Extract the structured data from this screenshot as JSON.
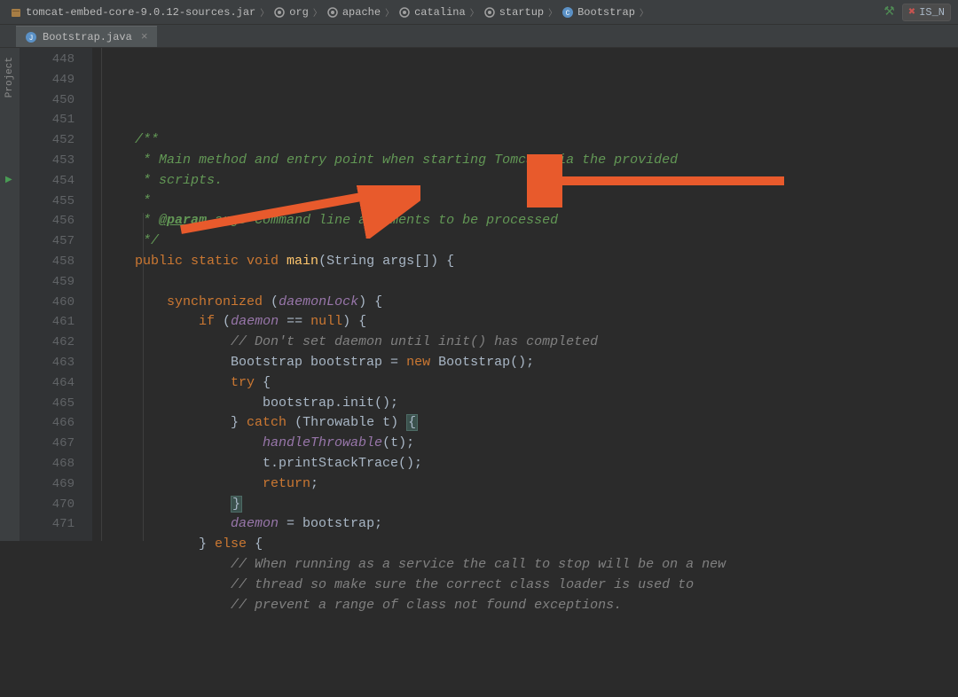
{
  "breadcrumb": {
    "items": [
      {
        "label": "tomcat-embed-core-9.0.12-sources.jar",
        "icon": "jar"
      },
      {
        "label": "org",
        "icon": "package"
      },
      {
        "label": "apache",
        "icon": "package"
      },
      {
        "label": "catalina",
        "icon": "package"
      },
      {
        "label": "startup",
        "icon": "package"
      },
      {
        "label": "Bootstrap",
        "icon": "class"
      }
    ]
  },
  "run_config": {
    "label": "IS_N"
  },
  "tab": {
    "filename": "Bootstrap.java"
  },
  "side_panel": {
    "label": "Project"
  },
  "gutter": {
    "start": 448,
    "end": 471
  },
  "code": {
    "lines": [
      {
        "type": "doc",
        "indent": 2,
        "segments": [
          {
            "t": "/**",
            "c": "doc-comment"
          }
        ]
      },
      {
        "type": "doc",
        "indent": 2,
        "segments": [
          {
            "t": " * Main method and entry point when starting Tomcat via the provided",
            "c": "doc-comment"
          }
        ]
      },
      {
        "type": "doc",
        "indent": 2,
        "segments": [
          {
            "t": " * scripts.",
            "c": "doc-comment"
          }
        ]
      },
      {
        "type": "doc",
        "indent": 2,
        "segments": [
          {
            "t": " *",
            "c": "doc-comment"
          }
        ]
      },
      {
        "type": "doc",
        "indent": 2,
        "segments": [
          {
            "t": " * ",
            "c": "doc-comment"
          },
          {
            "t": "@param",
            "c": "doc-tag"
          },
          {
            "t": " args Command line arguments to be processed",
            "c": "doc-comment"
          }
        ]
      },
      {
        "type": "doc",
        "indent": 2,
        "segments": [
          {
            "t": " */",
            "c": "doc-comment"
          }
        ]
      },
      {
        "type": "code",
        "indent": 2,
        "segments": [
          {
            "t": "public static void ",
            "c": "keyword"
          },
          {
            "t": "main",
            "c": "method-name"
          },
          {
            "t": "(String args[]) {",
            "c": "text-default"
          }
        ]
      },
      {
        "type": "blank"
      },
      {
        "type": "code",
        "indent": 3,
        "segments": [
          {
            "t": "synchronized ",
            "c": "keyword"
          },
          {
            "t": "(",
            "c": "text-default"
          },
          {
            "t": "daemonLock",
            "c": "field"
          },
          {
            "t": ") {",
            "c": "text-default"
          }
        ]
      },
      {
        "type": "code",
        "indent": 4,
        "segments": [
          {
            "t": "if ",
            "c": "keyword"
          },
          {
            "t": "(",
            "c": "text-default"
          },
          {
            "t": "daemon",
            "c": "field"
          },
          {
            "t": " == ",
            "c": "text-default"
          },
          {
            "t": "null",
            "c": "null-kw"
          },
          {
            "t": ") {",
            "c": "text-default"
          }
        ]
      },
      {
        "type": "code",
        "indent": 5,
        "segments": [
          {
            "t": "// Don't set daemon until init() has completed",
            "c": "comment"
          }
        ]
      },
      {
        "type": "code",
        "indent": 5,
        "segments": [
          {
            "t": "Bootstrap bootstrap = ",
            "c": "text-default"
          },
          {
            "t": "new ",
            "c": "keyword"
          },
          {
            "t": "Bootstrap();",
            "c": "text-default"
          }
        ]
      },
      {
        "type": "code",
        "indent": 5,
        "segments": [
          {
            "t": "try ",
            "c": "keyword"
          },
          {
            "t": "{",
            "c": "text-default"
          }
        ]
      },
      {
        "type": "code",
        "indent": 6,
        "segments": [
          {
            "t": "bootstrap.init();",
            "c": "text-default"
          }
        ]
      },
      {
        "type": "code",
        "indent": 5,
        "segments": [
          {
            "t": "} ",
            "c": "text-default"
          },
          {
            "t": "catch ",
            "c": "keyword"
          },
          {
            "t": "(Throwable t) ",
            "c": "text-default"
          },
          {
            "t": "{",
            "c": "brace-hl"
          }
        ]
      },
      {
        "type": "code",
        "indent": 6,
        "segments": [
          {
            "t": "handleThrowable",
            "c": "field"
          },
          {
            "t": "(t);",
            "c": "text-default"
          }
        ]
      },
      {
        "type": "code",
        "indent": 6,
        "segments": [
          {
            "t": "t.printStackTrace();",
            "c": "text-default"
          }
        ]
      },
      {
        "type": "code",
        "indent": 6,
        "segments": [
          {
            "t": "return",
            "c": "keyword"
          },
          {
            "t": ";",
            "c": "text-default"
          }
        ]
      },
      {
        "type": "code",
        "indent": 5,
        "segments": [
          {
            "t": "}",
            "c": "brace-hl"
          }
        ]
      },
      {
        "type": "code",
        "indent": 5,
        "segments": [
          {
            "t": "daemon",
            "c": "field"
          },
          {
            "t": " = bootstrap;",
            "c": "text-default"
          }
        ]
      },
      {
        "type": "code",
        "indent": 4,
        "segments": [
          {
            "t": "} ",
            "c": "text-default"
          },
          {
            "t": "else ",
            "c": "keyword"
          },
          {
            "t": "{",
            "c": "text-default"
          }
        ]
      },
      {
        "type": "code",
        "indent": 5,
        "segments": [
          {
            "t": "// When running as a service the call to stop will be on a new",
            "c": "comment"
          }
        ]
      },
      {
        "type": "code",
        "indent": 5,
        "segments": [
          {
            "t": "// thread so make sure the correct class loader is used to",
            "c": "comment"
          }
        ]
      },
      {
        "type": "code",
        "indent": 5,
        "segments": [
          {
            "t": "// prevent a range of class not found exceptions.",
            "c": "comment"
          }
        ]
      }
    ]
  }
}
